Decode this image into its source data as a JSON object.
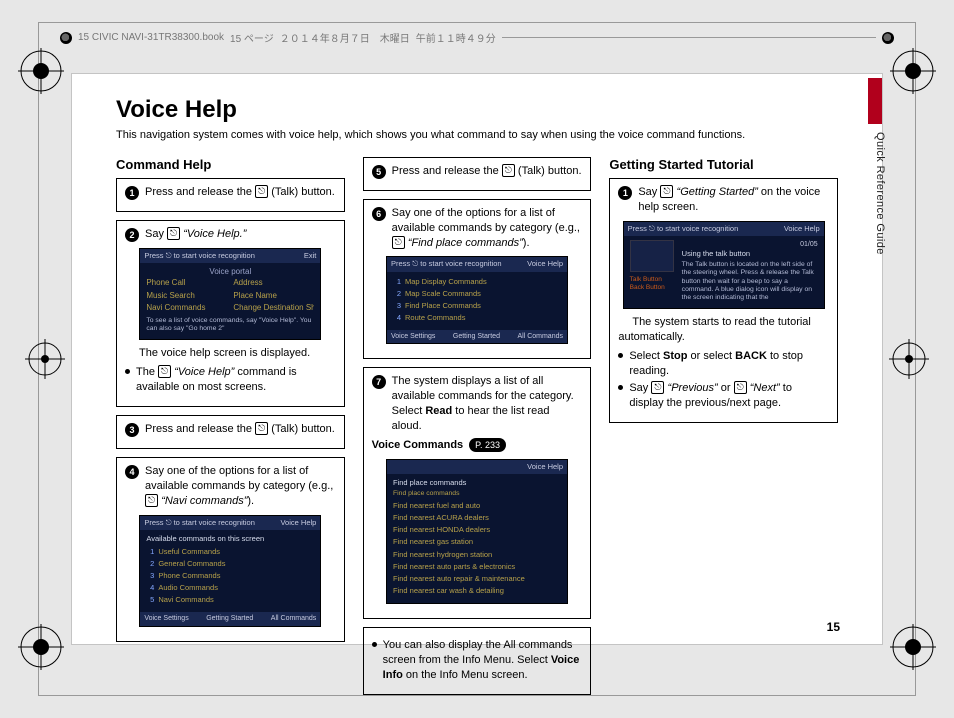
{
  "header": {
    "book_ref": "15 CIVIC NAVI-31TR38300.book",
    "page_token": "15 ページ",
    "date": "２０１４年８月７日　木曜日",
    "time": "午前１１時４９分"
  },
  "side_label": "Quick Reference Guide",
  "title": "Voice Help",
  "intro": "This navigation system comes with voice help, which shows you what command to say when using the voice command functions.",
  "page_number": "15",
  "talk_glyph": "⎋",
  "col1": {
    "heading": "Command Help",
    "box1": {
      "step_num": "1",
      "text_before": "Press and release the ",
      "text_after": " (Talk) button."
    },
    "box2": {
      "step_num": "2",
      "say_before": "Say ",
      "say_quote": "“Voice Help.”",
      "thumb": {
        "bar_left": "Press ⎋ to start voice recognition",
        "bar_right": "Exit",
        "portal_title": "Voice portal",
        "grid": [
          "Phone Call",
          "Address",
          "Music Search",
          "Place Name",
          "Navi Commands",
          "Change Destination Shortcuts"
        ],
        "note": "To see a list of voice commands, say \"Voice Help\". You can also say \"Go home 2\""
      },
      "caption": "The voice help screen is displayed.",
      "bullet_before": "The ",
      "bullet_quote": "“Voice Help”",
      "bullet_after": " command is available on most screens."
    },
    "box3": {
      "step_num": "3",
      "text_before": "Press and release the ",
      "text_after": " (Talk) button."
    },
    "box4": {
      "step_num": "4",
      "text_a": "Say one of the options for a list of available commands by category (e.g., ",
      "quote": "“Navi commands”",
      "text_b": ").",
      "thumb": {
        "bar_left": "Press ⎋ to start voice recognition",
        "bar_right": "Voice Help",
        "head": "Available commands on this screen",
        "rows": [
          {
            "n": "1",
            "t": "Useful Commands"
          },
          {
            "n": "2",
            "t": "General Commands"
          },
          {
            "n": "3",
            "t": "Phone Commands"
          },
          {
            "n": "4",
            "t": "Audio Commands"
          },
          {
            "n": "5",
            "t": "Navi Commands"
          }
        ],
        "foot": [
          "Voice Settings",
          "Getting Started",
          "All Commands"
        ]
      }
    }
  },
  "col2": {
    "box5": {
      "step_num": "5",
      "text_before": "Press and release the ",
      "text_after": " (Talk) button."
    },
    "box6": {
      "step_num": "6",
      "text_a": "Say one of the options for a list of available commands by category (e.g., ",
      "quote": "“Find place commands”",
      "text_b": ").",
      "thumb": {
        "bar_left": "Press ⎋ to start voice recognition",
        "bar_right": "Voice Help",
        "rows": [
          {
            "n": "1",
            "t": "Map Display Commands"
          },
          {
            "n": "2",
            "t": "Map Scale Commands"
          },
          {
            "n": "3",
            "t": "Find Place Commands"
          },
          {
            "n": "4",
            "t": "Route Commands"
          }
        ],
        "foot": [
          "Voice Settings",
          "Getting Started",
          "All Commands"
        ]
      }
    },
    "box7": {
      "step_num": "7",
      "text_a": "The system displays a list of all available commands for the category. Select ",
      "bold1": "Read",
      "text_b": " to hear the list read aloud.",
      "vc_label": "Voice Commands",
      "vc_page": "P. 233",
      "thumb": {
        "bar_right": "Voice Help",
        "head": "Find place commands",
        "sub": "Find place commands",
        "rows": [
          "Find nearest fuel and auto",
          "Find nearest ACURA dealers",
          "Find nearest HONDA dealers",
          "Find nearest gas station",
          "Find nearest hydrogen station",
          "Find nearest auto parts & electronics",
          "Find nearest auto repair & maintenance",
          "Find nearest car wash & detailing"
        ]
      }
    },
    "box8": {
      "bullet_a": "You can also display the All commands screen from the Info Menu. Select ",
      "bold": "Voice Info",
      "bullet_b": " on the Info Menu screen."
    }
  },
  "col3": {
    "heading": "Getting Started Tutorial",
    "box9": {
      "step_num": "1",
      "say_before": "Say ",
      "say_quote": "“Getting Started”",
      "say_after": " on the voice help screen.",
      "thumb": {
        "bar_left": "Press ⎋ to start voice recognition",
        "bar_right": "Voice Help",
        "time": "01/05",
        "head": "Using the talk button",
        "left_labels": [
          "Talk Button",
          "Back Button"
        ],
        "blurb": "The Talk button is located on the left side of the steering wheel. Press & release the Talk button then wait for a beep to say a command. A blue dialog icon will display on the screen indicating that the"
      },
      "caption": "The system starts to read the tutorial automatically.",
      "b1_a": "Select ",
      "b1_bold1": "Stop",
      "b1_mid": " or select ",
      "b1_bold2": "BACK",
      "b1_b": " to stop reading.",
      "b2_a": "Say ",
      "b2_q1": "“Previous”",
      "b2_mid": " or ",
      "b2_q2": "“Next”",
      "b2_b": " to display the previous/next page."
    }
  }
}
